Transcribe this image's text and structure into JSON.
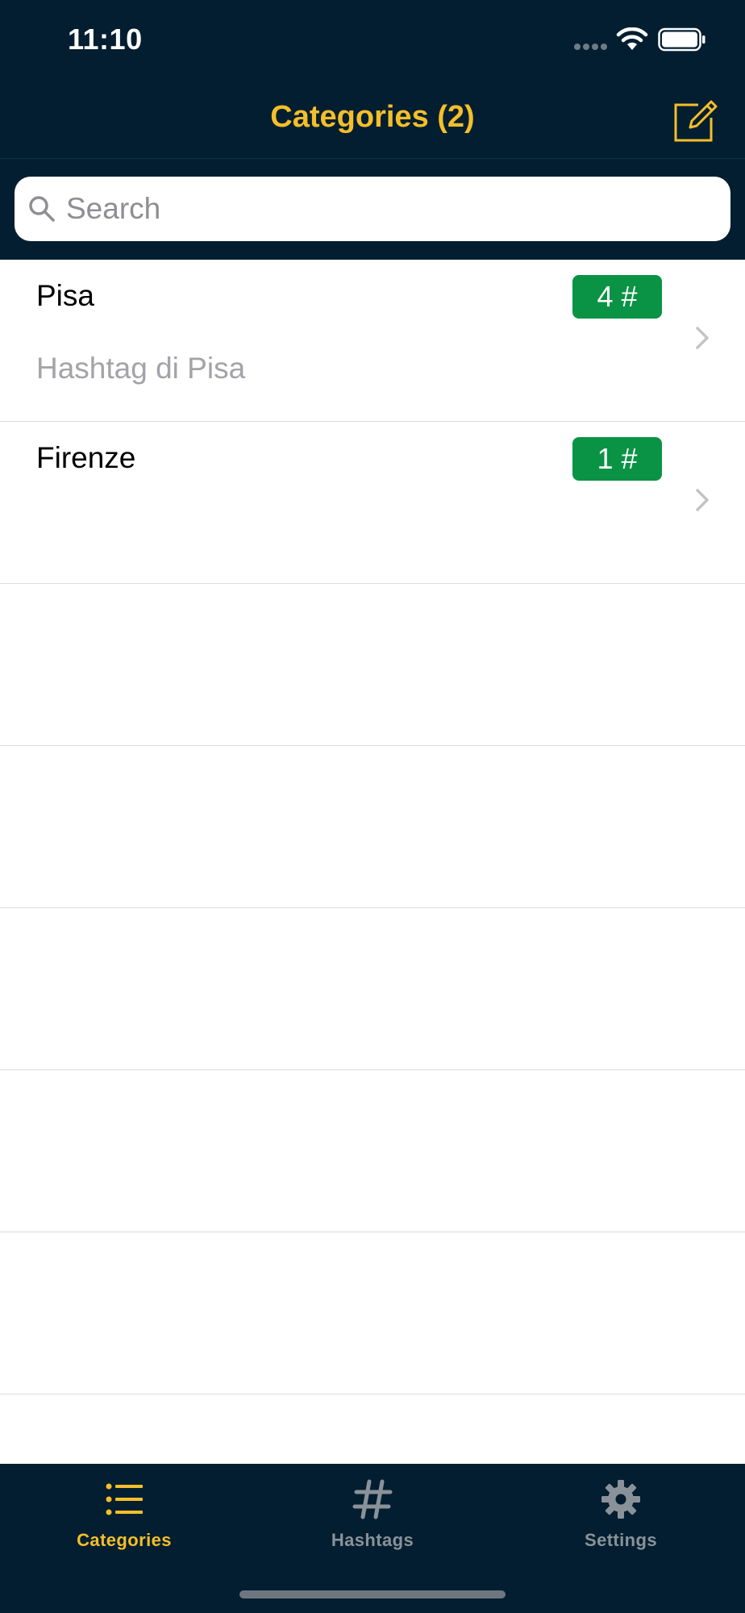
{
  "status_bar": {
    "time": "11:10"
  },
  "nav": {
    "title": "Categories (2)"
  },
  "search": {
    "placeholder": "Search",
    "value": ""
  },
  "categories": [
    {
      "name": "Pisa",
      "description": "Hashtag di Pisa",
      "count": "4 #"
    },
    {
      "name": "Firenze",
      "description": "",
      "count": "1 #"
    }
  ],
  "tabs": [
    {
      "label": "Categories",
      "icon": "list-icon",
      "selected": true
    },
    {
      "label": "Hashtags",
      "icon": "hashtag-icon",
      "selected": false
    },
    {
      "label": "Settings",
      "icon": "gear-icon",
      "selected": false
    }
  ],
  "colors": {
    "bar_background": "#031e30",
    "accent": "#f5be2a",
    "badge_green": "#0a9345",
    "tab_inactive": "#8a9299"
  }
}
